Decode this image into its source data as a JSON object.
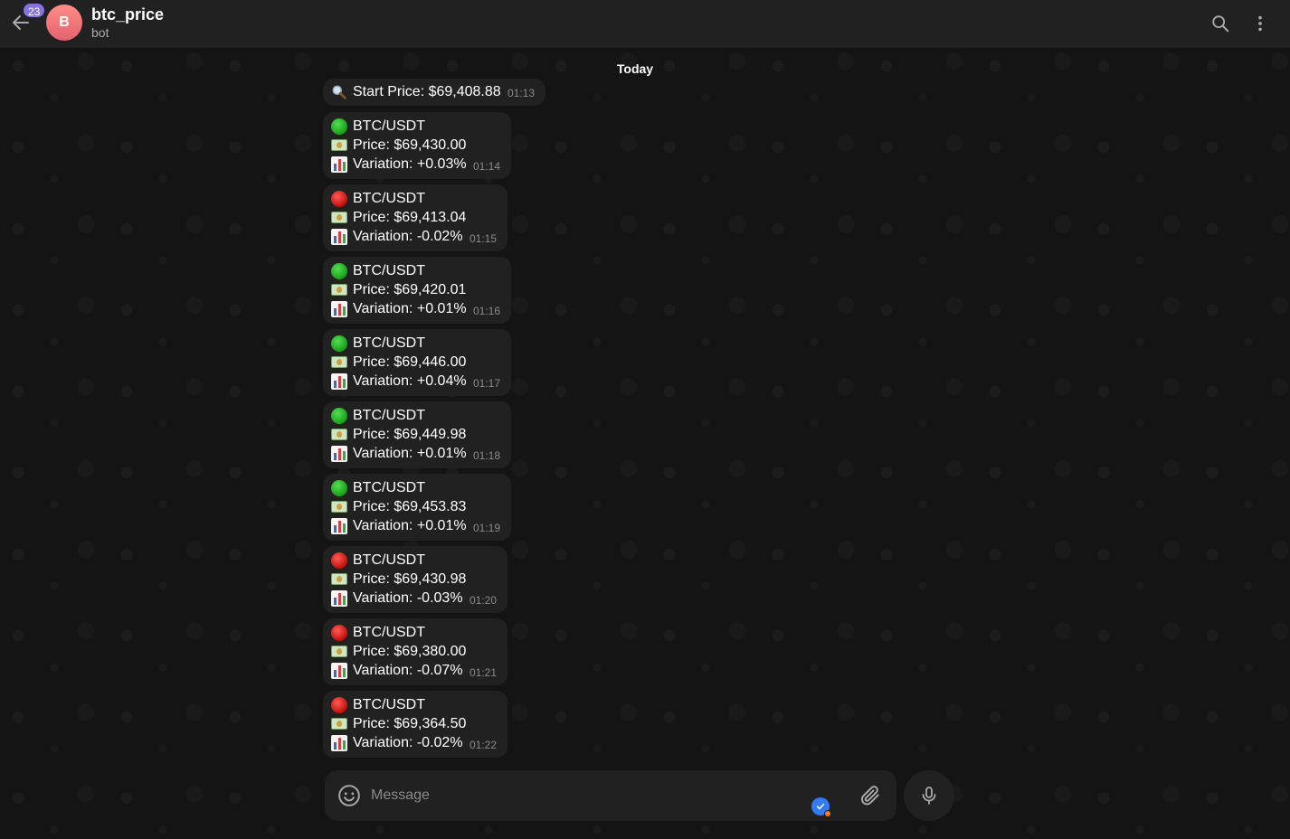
{
  "header": {
    "unread_count": "23",
    "avatar_letter": "B",
    "title": "btc_price",
    "subtitle": "bot"
  },
  "date_separator": "Today",
  "start_message": {
    "text": "Start Price: $69,408.88",
    "time": "01:13"
  },
  "messages": [
    {
      "indicator": "green",
      "pair": "BTC/USDT",
      "price": "Price: $69,430.00",
      "variation": "Variation: +0.03%",
      "time": "01:14"
    },
    {
      "indicator": "red",
      "pair": "BTC/USDT",
      "price": "Price: $69,413.04",
      "variation": "Variation: -0.02%",
      "time": "01:15"
    },
    {
      "indicator": "green",
      "pair": "BTC/USDT",
      "price": "Price: $69,420.01",
      "variation": "Variation: +0.01%",
      "time": "01:16"
    },
    {
      "indicator": "green",
      "pair": "BTC/USDT",
      "price": "Price: $69,446.00",
      "variation": "Variation: +0.04%",
      "time": "01:17"
    },
    {
      "indicator": "green",
      "pair": "BTC/USDT",
      "price": "Price: $69,449.98",
      "variation": "Variation: +0.01%",
      "time": "01:18"
    },
    {
      "indicator": "green",
      "pair": "BTC/USDT",
      "price": "Price: $69,453.83",
      "variation": "Variation: +0.01%",
      "time": "01:19"
    },
    {
      "indicator": "red",
      "pair": "BTC/USDT",
      "price": "Price: $69,430.98",
      "variation": "Variation: -0.03%",
      "time": "01:20"
    },
    {
      "indicator": "red",
      "pair": "BTC/USDT",
      "price": "Price: $69,380.00",
      "variation": "Variation: -0.07%",
      "time": "01:21"
    },
    {
      "indicator": "red",
      "pair": "BTC/USDT",
      "price": "Price: $69,364.50",
      "variation": "Variation: -0.02%",
      "time": "01:22"
    }
  ],
  "composer": {
    "placeholder": "Message"
  },
  "icons": {
    "back": "arrow-left-icon",
    "search": "search-icon",
    "menu": "more-vertical-icon",
    "emoji": "smile-icon",
    "attach": "paperclip-icon",
    "mic": "microphone-icon"
  },
  "colors": {
    "header_bg": "#212121",
    "bubble_bg": "#212121",
    "badge": "#8774e1",
    "up": "#15a11a",
    "down": "#c4100c"
  }
}
